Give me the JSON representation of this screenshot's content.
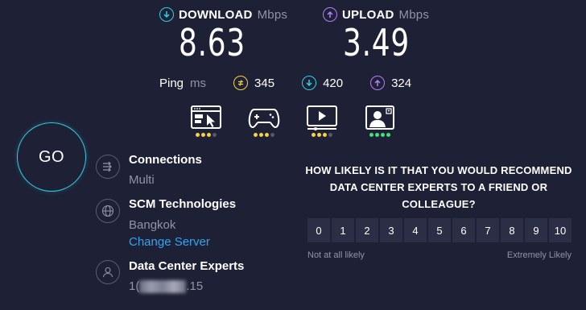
{
  "download": {
    "label": "DOWNLOAD",
    "unit": "Mbps",
    "value": "8.63",
    "color": "#2fd0e4"
  },
  "upload": {
    "label": "UPLOAD",
    "unit": "Mbps",
    "value": "3.49",
    "color": "#b57ef5"
  },
  "ping": {
    "label": "Ping",
    "unit": "ms",
    "idle": {
      "value": "345",
      "color": "#f5d142",
      "icon": "idle-ping-icon"
    },
    "download": {
      "value": "420",
      "color": "#2fd0e4",
      "icon": "download-ping-icon"
    },
    "upload": {
      "value": "324",
      "color": "#b57ef5",
      "icon": "upload-ping-icon"
    }
  },
  "quality": [
    {
      "name": "web-browsing-icon",
      "dots": [
        "yellow",
        "yellow",
        "yellow",
        "grey"
      ]
    },
    {
      "name": "gaming-icon",
      "dots": [
        "yellow",
        "yellow",
        "yellow",
        "grey"
      ]
    },
    {
      "name": "video-streaming-icon",
      "dots": [
        "yellow",
        "yellow",
        "yellow",
        "grey"
      ]
    },
    {
      "name": "video-chat-icon",
      "dots": [
        "green",
        "green",
        "green",
        "green"
      ]
    }
  ],
  "go_label": "GO",
  "connections": {
    "title": "Connections",
    "value": "Multi"
  },
  "isp": {
    "title": "SCM Technologies",
    "location": "Bangkok",
    "change_link": "Change Server"
  },
  "host": {
    "title": "Data Center Experts",
    "ip_start": "1(",
    "ip_end": ".15"
  },
  "survey": {
    "question": "HOW LIKELY IS IT THAT YOU WOULD RECOMMEND DATA CENTER EXPERTS TO A FRIEND OR COLLEAGUE?",
    "scale": [
      "0",
      "1",
      "2",
      "3",
      "4",
      "5",
      "6",
      "7",
      "8",
      "9",
      "10"
    ],
    "low_label": "Not at all likely",
    "high_label": "Extremely Likely"
  }
}
